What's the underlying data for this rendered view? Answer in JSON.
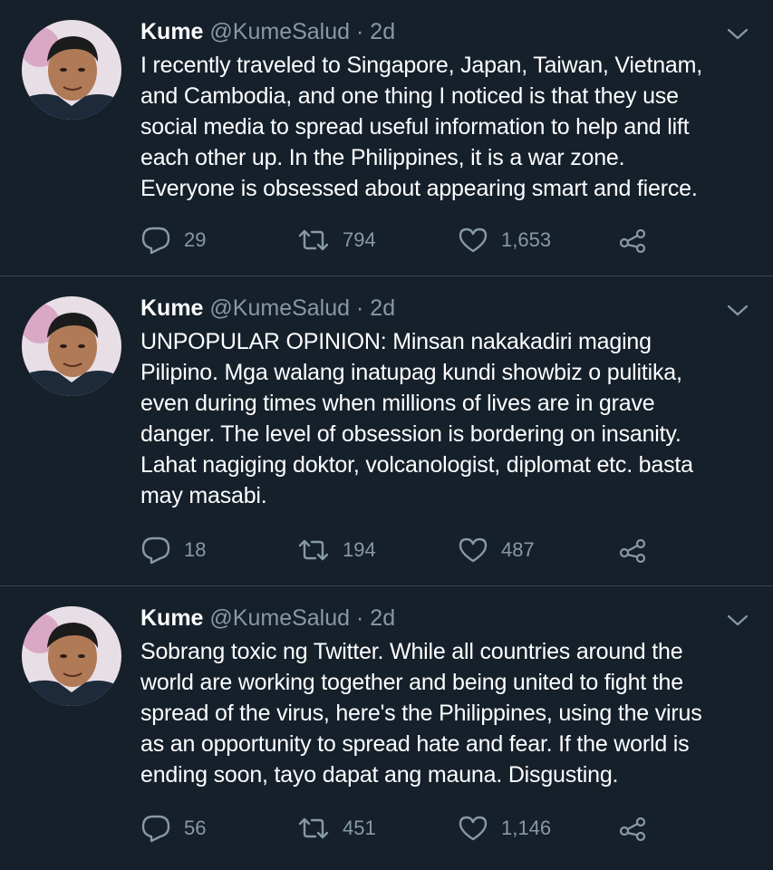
{
  "tweets": [
    {
      "name": "Kume",
      "handle": "@KumeSalud",
      "separator": "·",
      "time": "2d",
      "lines": [
        "I recently traveled to Singapore, Japan, Taiwan, Vietnam,",
        "and Cambodia, and one thing I noticed is that they use",
        "social media to spread useful information to help and lift",
        "each other up. In the Philippines, it is a war zone.",
        "Everyone is obsessed about appearing smart and fierce."
      ],
      "replies": "29",
      "retweets": "794",
      "likes": "1,653"
    },
    {
      "name": "Kume",
      "handle": "@KumeSalud",
      "separator": "·",
      "time": "2d",
      "lines": [
        "UNPOPULAR OPINION: Minsan nakakadiri maging",
        "Pilipino. Mga walang inatupag kundi showbiz o pulitika,",
        "even during times when millions of lives are in grave",
        "danger. The level of obsession is bordering on insanity.",
        "Lahat nagiging doktor, volcanologist, diplomat etc. basta",
        "may masabi."
      ],
      "replies": "18",
      "retweets": "194",
      "likes": "487"
    },
    {
      "name": "Kume",
      "handle": "@KumeSalud",
      "separator": "·",
      "time": "2d",
      "lines": [
        "Sobrang toxic ng Twitter. While all countries around the",
        "world are working together and being united to fight the",
        "spread of the virus, here's the Philippines, using the virus",
        "as an opportunity to spread hate and fear. If the world is",
        "ending soon, tayo dapat ang mauna. Disgusting."
      ],
      "replies": "56",
      "retweets": "451",
      "likes": "1,146"
    }
  ],
  "icons": {
    "reply": "reply-icon",
    "retweet": "retweet-icon",
    "like": "heart-icon",
    "share": "share-icon",
    "caret": "chevron-down-icon"
  },
  "colors": {
    "background": "#15202b",
    "text": "#ffffff",
    "secondary": "#8899a6",
    "divider": "#38444d"
  }
}
